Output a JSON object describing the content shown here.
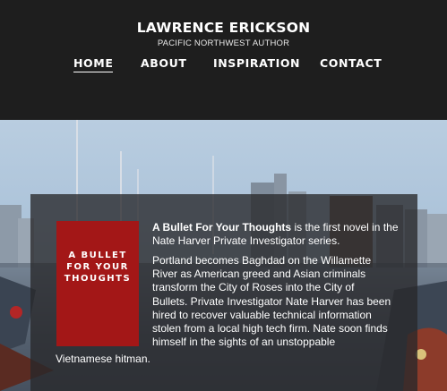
{
  "header": {
    "title": "LAWRENCE ERICKSON",
    "subtitle": "PACIFIC NORTHWEST AUTHOR"
  },
  "nav": {
    "items": [
      {
        "label": "HOME",
        "active": true
      },
      {
        "label": "ABOUT",
        "active": false
      },
      {
        "label": "INSPIRATION",
        "active": false
      },
      {
        "label": "CONTACT",
        "active": false
      }
    ]
  },
  "book": {
    "cover_line1": "A BULLET",
    "cover_line2": "FOR YOUR",
    "cover_line3": "THOUGHTS",
    "cover_color": "#a31717",
    "title": "A Bullet For Your Thoughts",
    "intro_rest": " is the first novel in the Nate Harver Private Investigator series.",
    "description_lines": [
      "Portland becomes Baghdad on the Willamette",
      "River as American greed and Asian criminals",
      "transform the City of Roses into the City of",
      "Bullets. Private Investigator Nate Harver has been",
      "hired to recover valuable technical information",
      "stolen from a local high tech firm. Nate soon finds",
      "himself in the sights of an unstoppable"
    ],
    "description_tail": "Vietnamese hitman."
  },
  "colors": {
    "header_bg": "#1e1e1e",
    "panel_bg": "rgba(40,40,42,0.78)",
    "text": "#ffffff"
  }
}
